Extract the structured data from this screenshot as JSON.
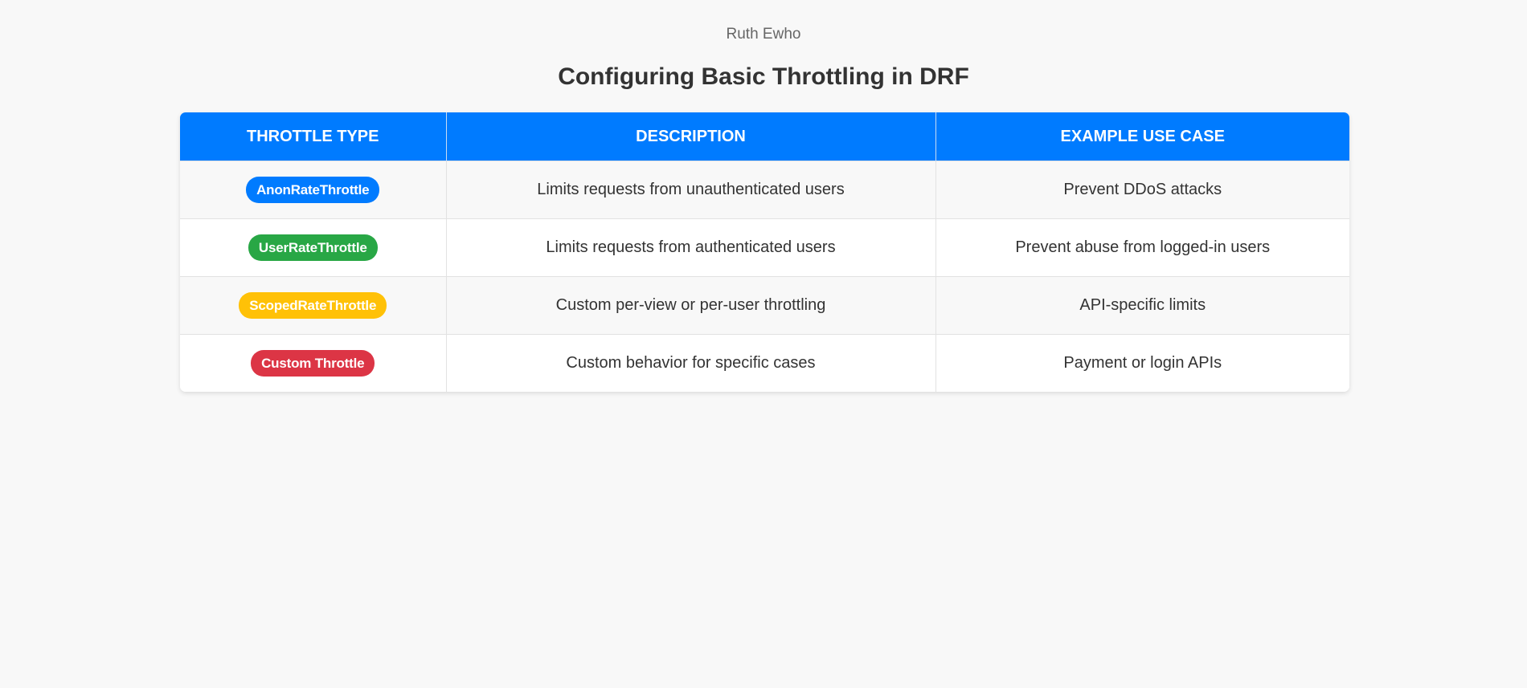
{
  "header": {
    "author": "Ruth Ewho",
    "title": "Configuring Basic Throttling in DRF"
  },
  "table": {
    "columns": [
      "Throttle Type",
      "Description",
      "Example Use Case"
    ],
    "rows": [
      {
        "type": "AnonRateThrottle",
        "badge_color": "#007bff",
        "description": "Limits requests from unauthenticated users",
        "use_case": "Prevent DDoS attacks"
      },
      {
        "type": "UserRateThrottle",
        "badge_color": "#28a745",
        "description": "Limits requests from authenticated users",
        "use_case": "Prevent abuse from logged-in users"
      },
      {
        "type": "ScopedRateThrottle",
        "badge_color": "#ffc107",
        "description": "Custom per-view or per-user throttling",
        "use_case": "API-specific limits"
      },
      {
        "type": "Custom Throttle",
        "badge_color": "#dc3545",
        "description": "Custom behavior for specific cases",
        "use_case": "Payment or login APIs"
      }
    ]
  },
  "colors": {
    "header_bg": "#007bff",
    "page_bg": "#f8f8f8"
  }
}
